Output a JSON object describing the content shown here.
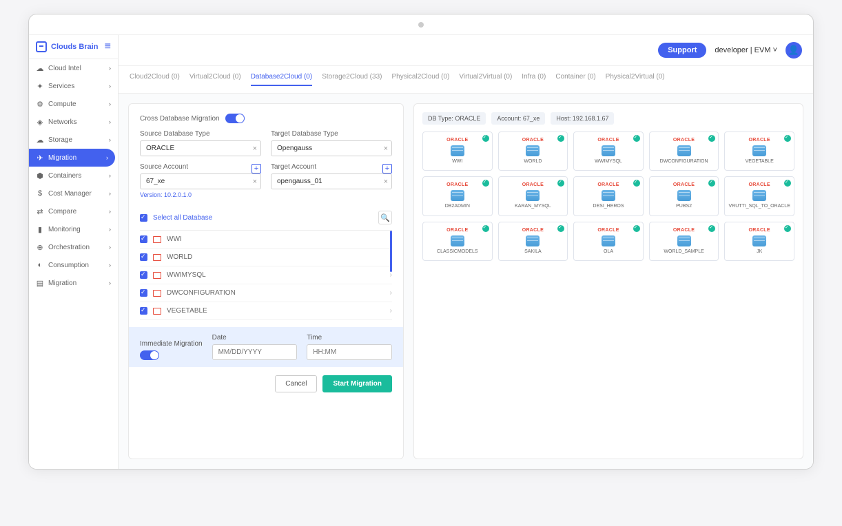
{
  "brand": "Clouds Brain",
  "header": {
    "support": "Support",
    "user": "developer | EVM"
  },
  "sidebar": [
    {
      "label": "Cloud Intel",
      "icon": "☁"
    },
    {
      "label": "Services",
      "icon": "✦"
    },
    {
      "label": "Compute",
      "icon": "⚙"
    },
    {
      "label": "Networks",
      "icon": "◈"
    },
    {
      "label": "Storage",
      "icon": "☁"
    },
    {
      "label": "Migration",
      "icon": "✈",
      "active": true
    },
    {
      "label": "Containers",
      "icon": "⬢"
    },
    {
      "label": "Cost Manager",
      "icon": "$"
    },
    {
      "label": "Compare",
      "icon": "⇄"
    },
    {
      "label": "Monitoring",
      "icon": "▮"
    },
    {
      "label": "Orchestration",
      "icon": "⊕"
    },
    {
      "label": "Consumption",
      "icon": "◐"
    },
    {
      "label": "Migration",
      "icon": "▤"
    }
  ],
  "tabs": [
    {
      "label": "Cloud2Cloud (0)"
    },
    {
      "label": "Virtual2Cloud (0)"
    },
    {
      "label": "Database2Cloud (0)",
      "active": true
    },
    {
      "label": "Storage2Cloud (33)"
    },
    {
      "label": "Physical2Cloud (0)"
    },
    {
      "label": "Virtual2Virtual (0)"
    },
    {
      "label": "Infra (0)"
    },
    {
      "label": "Container (0)"
    },
    {
      "label": "Physical2Virtual (0)"
    }
  ],
  "form": {
    "cross_label": "Cross Database Migration",
    "src_type_label": "Source Database Type",
    "tgt_type_label": "Target Database Type",
    "src_type": "ORACLE",
    "tgt_type": "Opengauss",
    "src_acct_label": "Source Account",
    "tgt_acct_label": "Target Account",
    "src_acct": "67_xe",
    "tgt_acct": "opengauss_01",
    "version": "Version: 10.2.0.1.0",
    "select_all": "Select all Database",
    "databases": [
      "WWI",
      "WORLD",
      "WWIMYSQL",
      "DWCONFIGURATION",
      "VEGETABLE"
    ],
    "immediate_label": "Immediate Migration",
    "date_label": "Date",
    "date_ph": "MM/DD/YYYY",
    "time_label": "Time",
    "time_ph": "HH:MM",
    "cancel": "Cancel",
    "start": "Start Migration"
  },
  "meta": {
    "dbtype": "DB Type: ORACLE",
    "account": "Account: 67_xe",
    "host": "Host: 192.168.1.67"
  },
  "cards": [
    "WWI",
    "WORLD",
    "WWIMYSQL",
    "DWCONFIGURATION",
    "VEGETABLE",
    "DB2ADMIN",
    "KARAN_MYSQL",
    "DESI_HEROS",
    "PUBS2",
    "VRUTTI_SQL_TO_ORACLE",
    "CLASSICMODELS",
    "SAKILA",
    "OLA",
    "WORLD_SAMPLE",
    "JK"
  ],
  "oracle": "ORACLE"
}
